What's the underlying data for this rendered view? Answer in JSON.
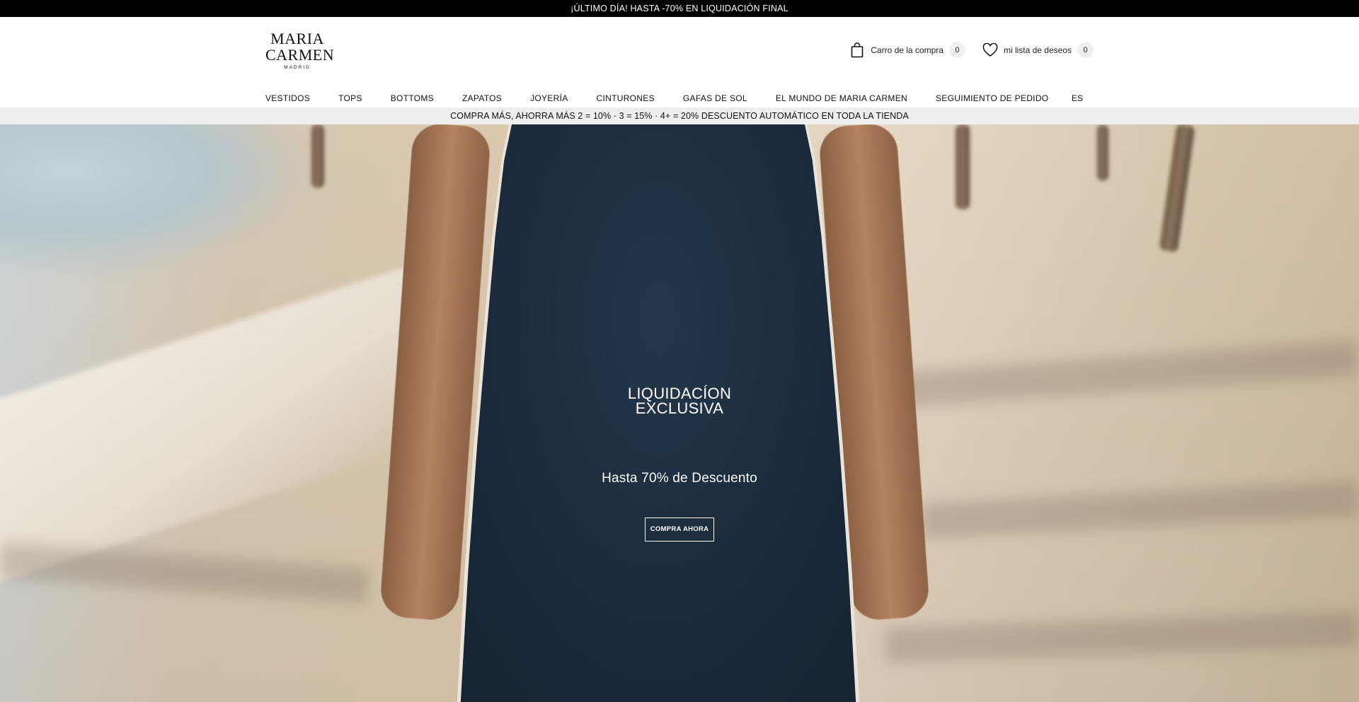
{
  "topbar": {
    "text": "¡ÚLTIMO DÍA! HASTA -70% EN LIQUIDACIÓN FINAL"
  },
  "logo": {
    "line1": "MARIA",
    "line2": "CARMEN",
    "line3": "MADRID"
  },
  "header": {
    "cart": {
      "label": "Carro de la compra",
      "count": "0",
      "icon": "shopping-bag-icon"
    },
    "wishlist": {
      "label": "mi lista de deseos",
      "count": "0",
      "icon": "heart-icon"
    }
  },
  "nav": {
    "items": [
      "VESTIDOS",
      "TOPS",
      "BOTTOMS",
      "ZAPATOS",
      "JOYERÍA",
      "CINTURONES",
      "GAFAS DE SOL",
      "EL MUNDO DE MARIA CARMEN",
      "SEGUIMIENTO DE PEDIDO"
    ],
    "language": "ES"
  },
  "promo": {
    "text": "COMPRA MÁS, AHORRA MÁS 2 = 10% · 3 = 15% · 4+ = 20% DESCUENTO AUTOMÁTICO EN TODA LA TIENDA"
  },
  "hero": {
    "title_line1": "LIQUIDACÍON",
    "title_line2": "EXCLUSIVA",
    "subtitle": "Hasta 70% de Descuento",
    "button": "COMPRA AHORA"
  },
  "colors": {
    "topbar_bg": "#000000",
    "promo_bg": "#efefee",
    "dress": "#1b2b3c"
  }
}
